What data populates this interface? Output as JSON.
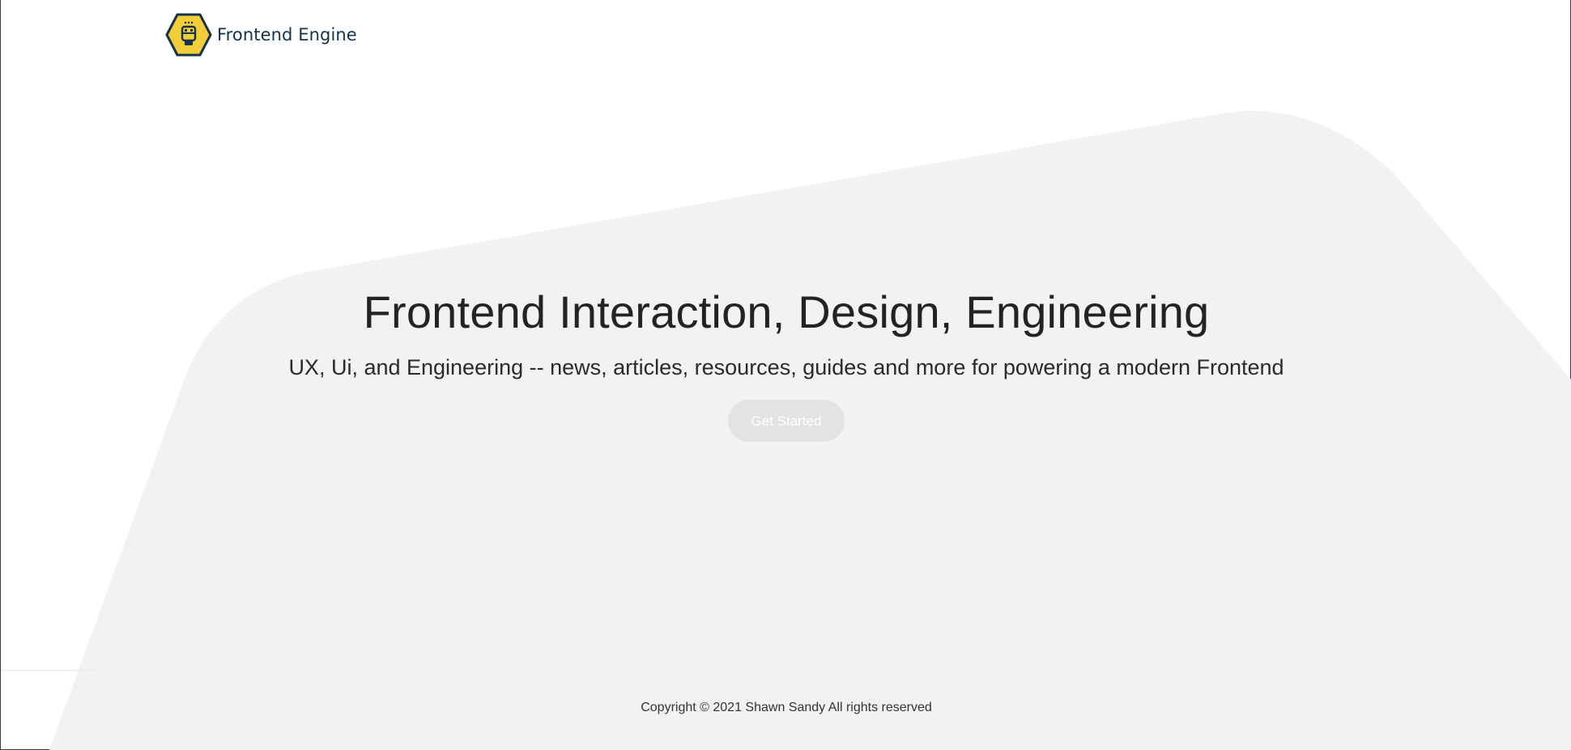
{
  "header": {
    "brand_name": "Frontend Engine",
    "logo_icon": "robot-hexagon-icon"
  },
  "hero": {
    "title": "Frontend Interaction, Design, Engineering",
    "subtitle": "UX, Ui, and Engineering -- news, articles, resources, guides and more for powering a modern Frontend",
    "cta_label": "Get Started"
  },
  "footer": {
    "copyright": "Copyright © 2021 Shawn Sandy All rights reserved"
  },
  "colors": {
    "background": "#ffffff",
    "hero_shape": "#f1f2f4",
    "brand_text": "#14324a",
    "logo_fill": "#f4cd3a",
    "logo_stroke": "#14324a",
    "cta_background": "#e2e3e5",
    "cta_text": "#ffffff"
  }
}
